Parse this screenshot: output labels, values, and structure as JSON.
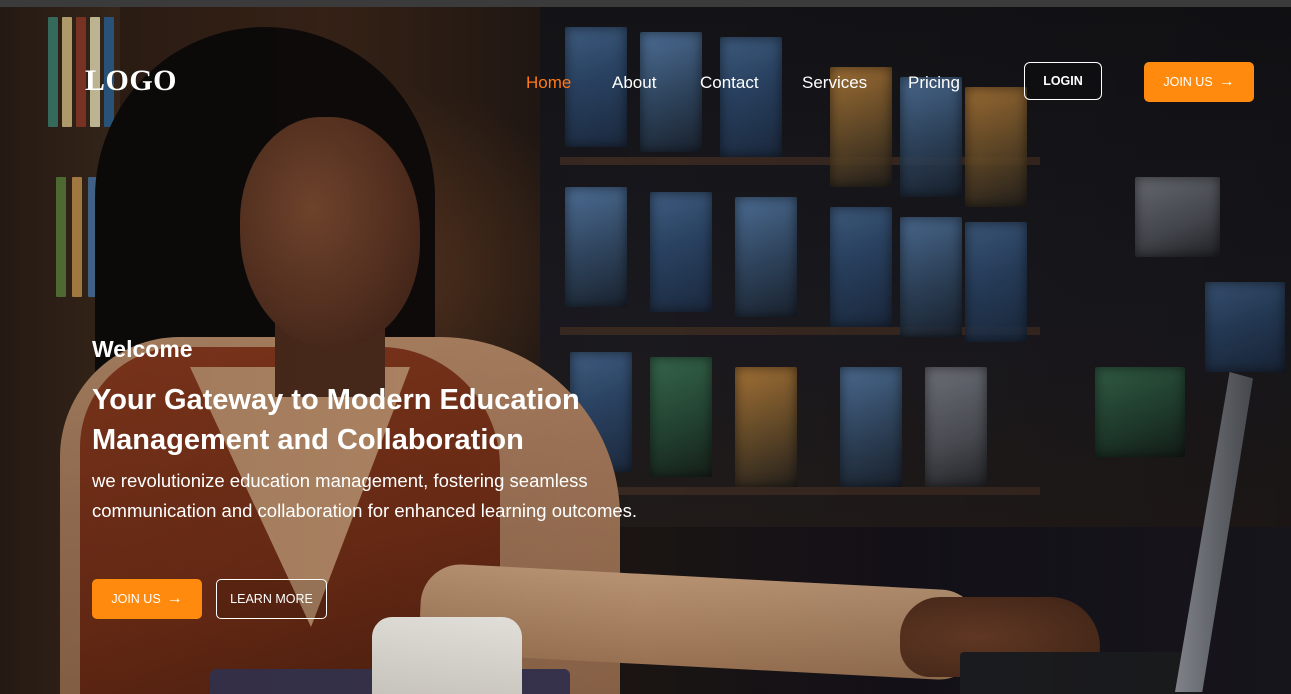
{
  "header": {
    "logo": "LOGO",
    "nav": [
      {
        "label": "Home",
        "active": true
      },
      {
        "label": "About",
        "active": false
      },
      {
        "label": "Contact",
        "active": false
      },
      {
        "label": "Services",
        "active": false
      },
      {
        "label": "Pricing",
        "active": false
      }
    ],
    "login_label": "LOGIN",
    "join_label": "JOIN US"
  },
  "hero": {
    "welcome": "Welcome",
    "headline_line1": "Your Gateway to Modern Education",
    "headline_line2": "Management and Collaboration",
    "subtext": "we revolutionize education management, fostering seamless communication and collaboration for enhanced learning outcomes.",
    "join_label": "JOIN US",
    "learn_more_label": "LEARN MORE"
  },
  "icons": {
    "arrow": "arrow-right-icon"
  },
  "colors": {
    "accent": "#ff8a0d",
    "active_nav": "#ff7a1a",
    "text": "#ffffff"
  }
}
